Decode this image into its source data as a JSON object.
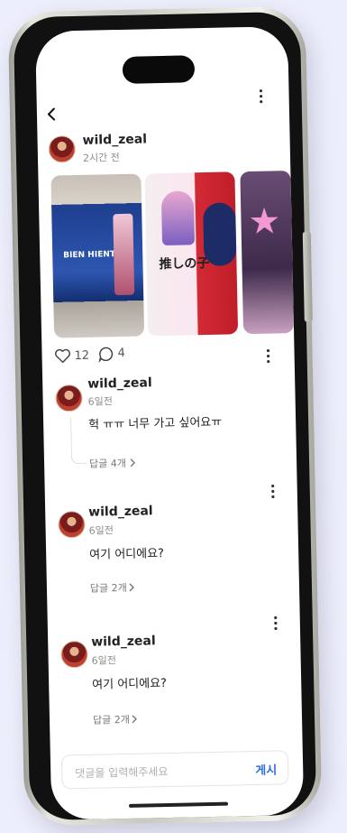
{
  "header": {
    "back_icon": "chevron-left-icon",
    "more_icon": "more-vertical-icon"
  },
  "post": {
    "username": "wild_zeal",
    "time": "2시간 전",
    "likes": "12",
    "comments": "4",
    "photos": [
      {
        "name": "exhibition-photo-1",
        "caption": "BIEN HIENTO"
      },
      {
        "name": "exhibition-photo-2",
        "caption": "推しの子"
      },
      {
        "name": "exhibition-photo-3",
        "caption": ""
      },
      {
        "name": "exhibition-photo-4",
        "caption": ""
      }
    ]
  },
  "comments": [
    {
      "username": "wild_zeal",
      "time": "6일전",
      "text": "헉 ㅠㅠ 너무 가고 싶어요ㅠ",
      "replies": "답글 4개"
    },
    {
      "username": "wild_zeal",
      "time": "6일전",
      "text": "여기 어디에요?",
      "replies": "답글 2개"
    },
    {
      "username": "wild_zeal",
      "time": "6일전",
      "text": "여기 어디에요?",
      "replies": "답글 2개"
    }
  ],
  "composer": {
    "placeholder": "댓글을 입력해주세요",
    "submit_label": "게시"
  },
  "colors": {
    "background": "#eceefb",
    "accent": "#2e6de8"
  }
}
